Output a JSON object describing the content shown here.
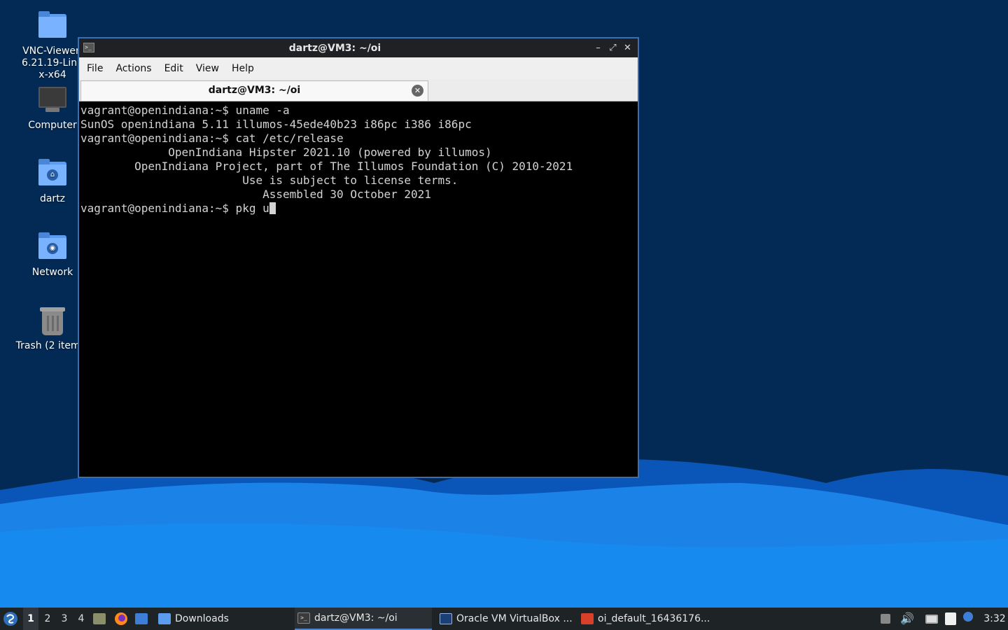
{
  "desktop": {
    "icons": [
      {
        "label": "VNC-Viewer-6.21.19-Linux-x64",
        "icon": "folder-icon"
      },
      {
        "label": "Computer",
        "icon": "computer-icon"
      },
      {
        "label": "dartz",
        "icon": "home-folder-icon"
      },
      {
        "label": "Network",
        "icon": "network-folder-icon"
      },
      {
        "label": "Trash (2 items)",
        "icon": "trash-icon"
      }
    ]
  },
  "terminal": {
    "title": "dartz@VM3: ~/oi",
    "menu": [
      "File",
      "Actions",
      "Edit",
      "View",
      "Help"
    ],
    "tab_label": "dartz@VM3: ~/oi",
    "lines": [
      "vagrant@openindiana:~$ uname -a",
      "SunOS openindiana 5.11 illumos-45ede40b23 i86pc i386 i86pc",
      "vagrant@openindiana:~$ cat /etc/release",
      "             OpenIndiana Hipster 2021.10 (powered by illumos)",
      "        OpenIndiana Project, part of The Illumos Foundation (C) 2010-2021",
      "                        Use is subject to license terms.",
      "                           Assembled 30 October 2021"
    ],
    "current_input": "vagrant@openindiana:~$ pkg u"
  },
  "taskbar": {
    "workspaces": [
      "1",
      "2",
      "3",
      "4"
    ],
    "active_workspace": "1",
    "tasks": [
      {
        "label": "Downloads",
        "icon": "folder-icon"
      },
      {
        "label": "dartz@VM3: ~/oi",
        "icon": "terminal-icon",
        "active": true
      },
      {
        "label": "Oracle VM VirtualBox ...",
        "icon": "virtualbox-icon"
      },
      {
        "label": "oi_default_16436176...",
        "icon": "pdf-icon"
      }
    ],
    "clock": "3:32"
  },
  "colors": {
    "accent": "#3c6db0",
    "terminal_bg": "#000000",
    "terminal_fg": "#d3d3d3"
  }
}
